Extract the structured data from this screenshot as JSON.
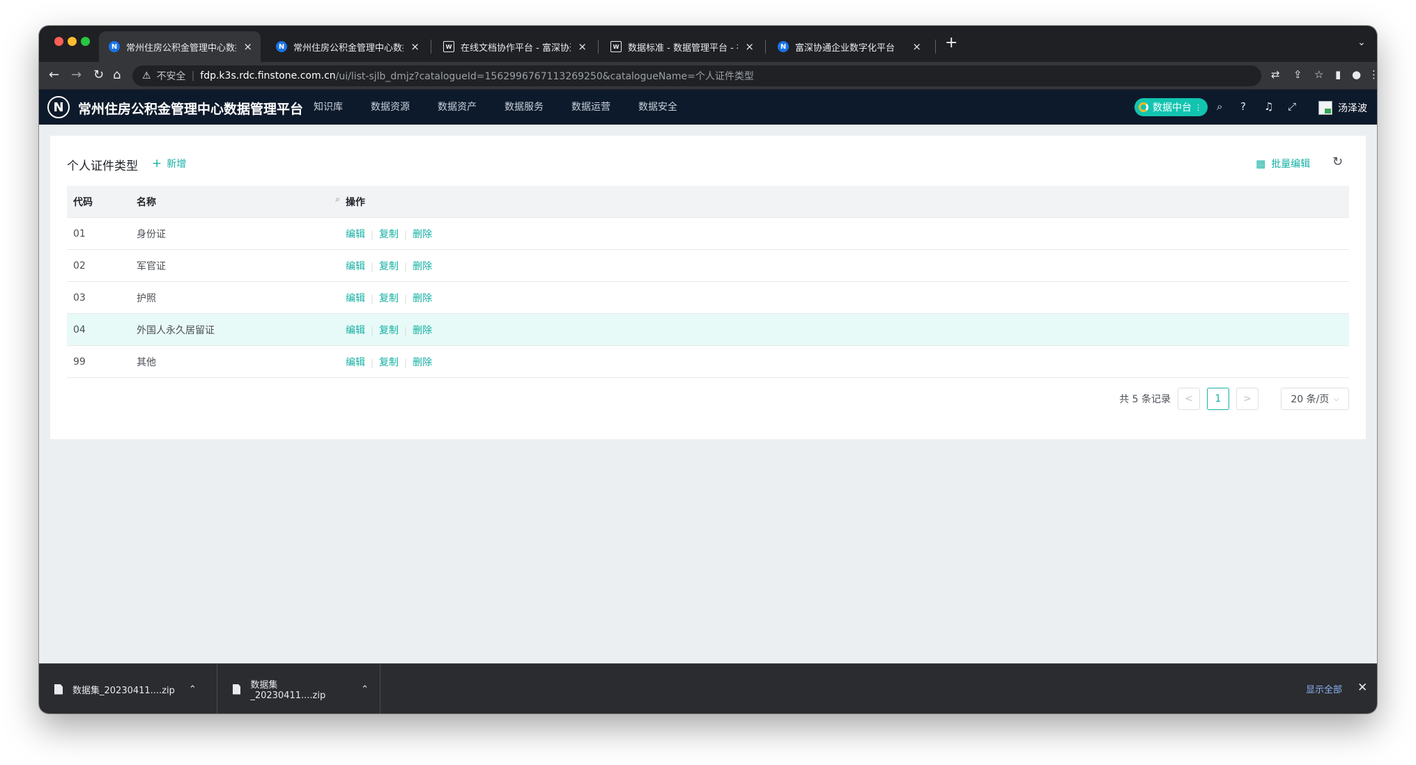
{
  "browser": {
    "tabs": [
      {
        "title": "常州住房公积金管理中心数据管理平",
        "icon": "N",
        "active": true
      },
      {
        "title": "常州住房公积金管理中心数据管理平",
        "icon": "N",
        "active": false
      },
      {
        "title": "在线文档协作平台 - 富深协通",
        "icon": "doc",
        "active": false
      },
      {
        "title": "数据标准 - 数据管理平台 - 在线文",
        "icon": "doc",
        "active": false
      },
      {
        "title": "富深协通企业数字化平台",
        "icon": "N",
        "active": false
      }
    ],
    "new_tab": "+",
    "url": {
      "security_label": "不安全",
      "host": "fdp.k3s.rdc.finstone.com.cn",
      "path": "/ui/list-sjlb_dmjz?catalogueId=1562996767113269250&catalogueName=个人证件类型"
    }
  },
  "app": {
    "logo_letter": "N",
    "title": "常州住房公积金管理中心数据管理平台",
    "nav": [
      "知识库",
      "数据资源",
      "数据资产",
      "数据服务",
      "数据运营",
      "数据安全"
    ],
    "badge": "数据中台",
    "username": "汤泽波"
  },
  "page": {
    "title": "个人证件类型",
    "add_label": "新增",
    "batch_edit_label": "批量编辑"
  },
  "table": {
    "headers": {
      "code": "代码",
      "name": "名称",
      "actions": "操作"
    },
    "action_labels": {
      "edit": "编辑",
      "copy": "复制",
      "delete": "删除"
    },
    "rows": [
      {
        "code": "01",
        "name": "身份证"
      },
      {
        "code": "02",
        "name": "军官证"
      },
      {
        "code": "03",
        "name": "护照"
      },
      {
        "code": "04",
        "name": "外国人永久居留证",
        "highlighted": true
      },
      {
        "code": "99",
        "name": "其他"
      }
    ]
  },
  "pagination": {
    "total_text": "共 5 条记录",
    "prev": "<",
    "current": "1",
    "next": ">",
    "page_size": "20 条/页"
  },
  "downloads": {
    "items": [
      "数据集_20230411....zip",
      "数据集_20230411....zip"
    ],
    "show_all": "显示全部"
  },
  "colors": {
    "accent": "#14b0a4",
    "header_bg": "#0d1a2b",
    "row_highlight": "#e8faf7"
  }
}
